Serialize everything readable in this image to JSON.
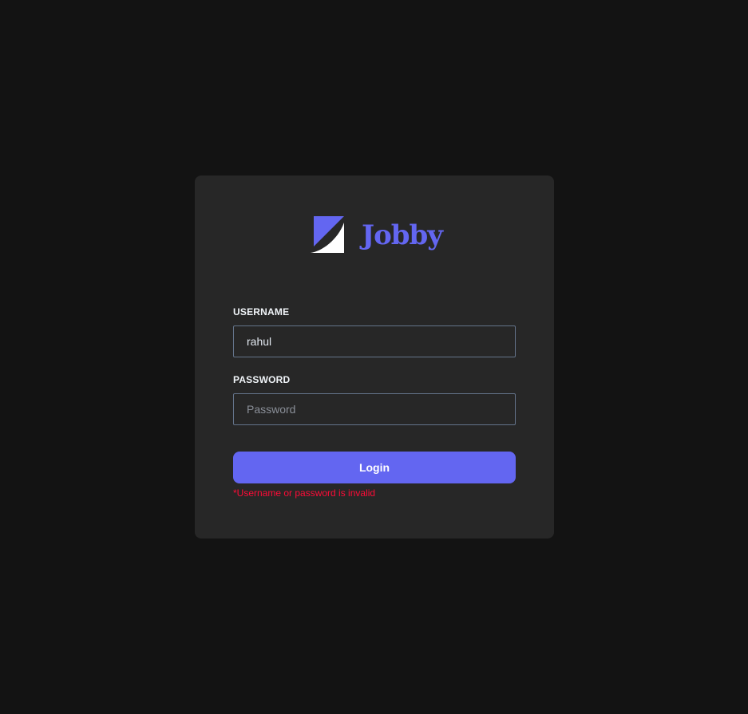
{
  "brand": {
    "name": "Jobby",
    "logo_icon": "jobby-logo-icon",
    "accent_color": "#6366f1"
  },
  "form": {
    "username_label": "USERNAME",
    "username_value": "rahul",
    "password_label": "PASSWORD",
    "password_placeholder": "Password",
    "password_value": "",
    "login_label": "Login",
    "error_message": "*Username or password is invalid",
    "error_color": "#ff0b37"
  }
}
